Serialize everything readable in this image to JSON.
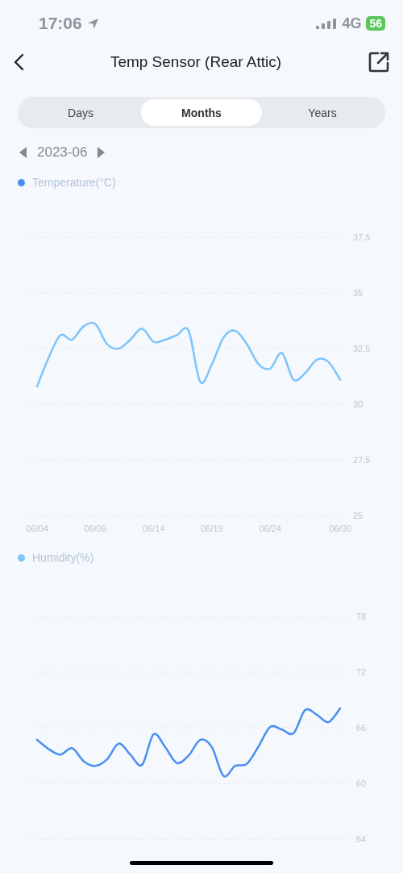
{
  "status_bar": {
    "time": "17:06",
    "network": "4G",
    "battery": "56"
  },
  "header": {
    "title": "Temp Sensor (Rear Attic)"
  },
  "tabs": [
    {
      "label": "Days",
      "selected": false
    },
    {
      "label": "Months",
      "selected": true
    },
    {
      "label": "Years",
      "selected": false
    }
  ],
  "period": {
    "label": "2023-06"
  },
  "charts": [
    {
      "legend": {
        "label": "Temperature(°C)",
        "color": "#4a8ff0"
      },
      "chart_data": {
        "type": "line",
        "categories": [
          "06/04",
          null,
          null,
          null,
          null,
          "06/09",
          null,
          null,
          null,
          null,
          "06/14",
          null,
          null,
          null,
          null,
          "06/19",
          null,
          null,
          null,
          null,
          "06/24",
          null,
          null,
          null,
          null,
          null,
          "06/30"
        ],
        "ylim": [
          25,
          37.5
        ],
        "yticks": [
          25,
          27.5,
          30,
          32.5,
          35,
          37.5
        ],
        "grid": true,
        "series": [
          {
            "color": "#7cc4fa",
            "values": [
              30.8,
              32.1,
              33.1,
              32.9,
              33.5,
              33.6,
              32.7,
              32.5,
              32.9,
              33.4,
              32.8,
              32.9,
              33.1,
              33.3,
              31.0,
              31.8,
              33.0,
              33.3,
              32.7,
              31.8,
              31.6,
              32.3,
              31.1,
              31.4,
              32.0,
              31.9,
              31.1
            ]
          }
        ]
      }
    },
    {
      "legend": {
        "label": "Humidity(%)",
        "color": "#7cc4fa"
      },
      "chart_data": {
        "type": "line",
        "ylim": [
          54,
          78
        ],
        "yticks": [
          54,
          60,
          66,
          72,
          78
        ],
        "grid": true,
        "series": [
          {
            "color": "#4a8ff0",
            "values": [
              64.7,
              63.7,
              63.1,
              63.8,
              62.4,
              61.9,
              62.6,
              64.3,
              63.1,
              62.0,
              65.3,
              63.9,
              62.2,
              63.0,
              64.7,
              63.9,
              60.8,
              61.9,
              62.1,
              64.0,
              66.1,
              65.8,
              65.4,
              67.9,
              67.4,
              66.6,
              68.1
            ]
          }
        ]
      }
    }
  ]
}
